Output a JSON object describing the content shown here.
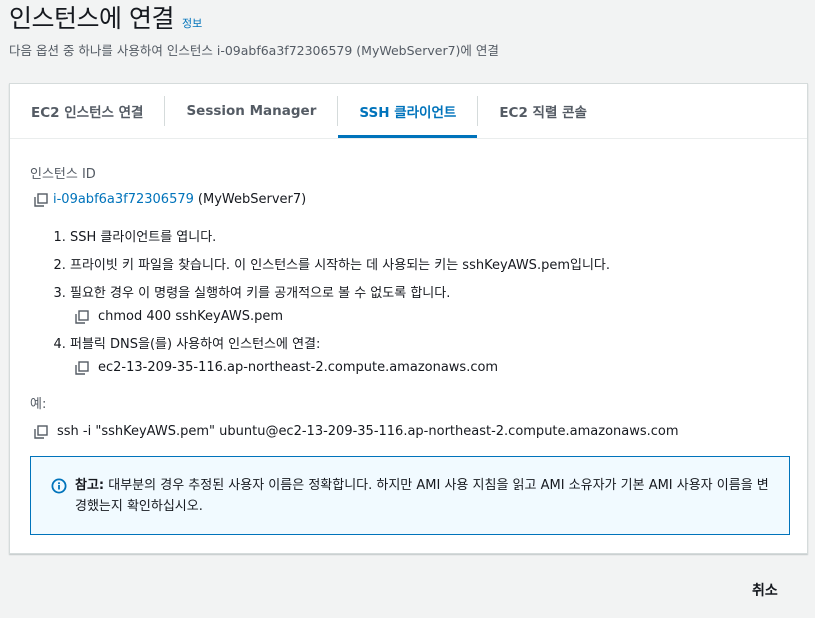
{
  "header": {
    "title": "인스턴스에 연결",
    "info_link": "정보",
    "subtitle": "다음 옵션 중 하나를 사용하여 인스턴스 i-09abf6a3f72306579 (MyWebServer7)에 연결"
  },
  "tabs": [
    {
      "label": "EC2 인스턴스 연결",
      "active": false
    },
    {
      "label": "Session Manager",
      "active": false
    },
    {
      "label": "SSH 클라이언트",
      "active": true
    },
    {
      "label": "EC2 직렬 콘솔",
      "active": false
    }
  ],
  "instance": {
    "label": "인스턴스 ID",
    "id": "i-09abf6a3f72306579",
    "name": "(MyWebServer7)"
  },
  "steps": [
    {
      "text": "SSH 클라이언트를 엽니다."
    },
    {
      "text": "프라이빗 키 파일을 찾습니다. 이 인스턴스를 시작하는 데 사용되는 키는 sshKeyAWS.pem입니다."
    },
    {
      "text": "필요한 경우 이 명령을 실행하여 키를 공개적으로 볼 수 없도록 합니다.",
      "code": "chmod 400 sshKeyAWS.pem"
    },
    {
      "text": "퍼블릭 DNS을(를) 사용하여 인스턴스에 연결:",
      "code": "ec2-13-209-35-116.ap-northeast-2.compute.amazonaws.com"
    }
  ],
  "example": {
    "label": "예:",
    "command": "ssh -i \"sshKeyAWS.pem\" ubuntu@ec2-13-209-35-116.ap-northeast-2.compute.amazonaws.com"
  },
  "notice": {
    "prefix": "참고:",
    "text": " 대부분의 경우 추정된 사용자 이름은 정확합니다. 하지만 AMI 사용 지침을 읽고 AMI 소유자가 기본 AMI 사용자 이름을 변경했는지 확인하십시오."
  },
  "footer": {
    "cancel": "취소"
  },
  "colors": {
    "accent": "#0073bb",
    "info_bg": "#f1faff"
  }
}
